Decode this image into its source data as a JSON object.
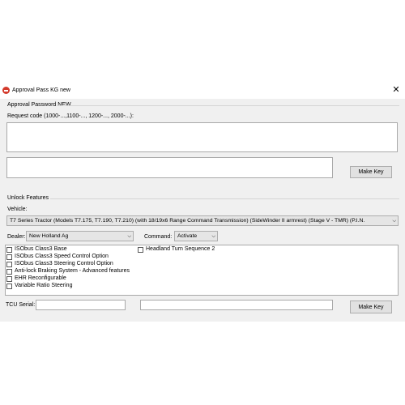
{
  "window": {
    "title": "Approval Pass KG new",
    "close_glyph": "✕"
  },
  "approval": {
    "group_label": "Approval Password NEW",
    "request_label": "Request code (1000-...,1100-..., 1200-..., 2000-...):",
    "request_value": "",
    "output_value": "",
    "make_key_label": "Make Key"
  },
  "unlock": {
    "group_label": "Unlock Features",
    "vehicle_label": "Vehicle:",
    "vehicle_value": "T7 Series Tractor (Models T7.175, T7.190, T7.210) (with 18/19x6 Range Command Transmission) (SideWinder II armrest) (Stage V - TMR) (P.I.N.",
    "dealer_label": "Dealer:",
    "dealer_value": "New Holland Ag",
    "command_label": "Command:",
    "command_value": "Activate",
    "features": [
      {
        "label": "ISObus Class3 Base",
        "checked": false
      },
      {
        "label": "ISObus Class3 Speed Control Option",
        "checked": false
      },
      {
        "label": "ISObus Class3 Steering Control Option",
        "checked": false
      },
      {
        "label": "Anti-lock Braking System - Advanced features",
        "checked": false
      },
      {
        "label": "EHR Reconfigurable",
        "checked": false
      },
      {
        "label": "Variable Ratio Steering",
        "checked": false
      },
      {
        "label": "Headland Turn Sequence 2",
        "checked": false
      }
    ],
    "tcu_label": "TCU Serial:",
    "tcu_value": "",
    "key_value": "",
    "make_key_label": "Make Key"
  },
  "icons": {
    "app": "app-logo-icon",
    "close": "close-icon",
    "dropdown": "chevron-down-icon"
  }
}
